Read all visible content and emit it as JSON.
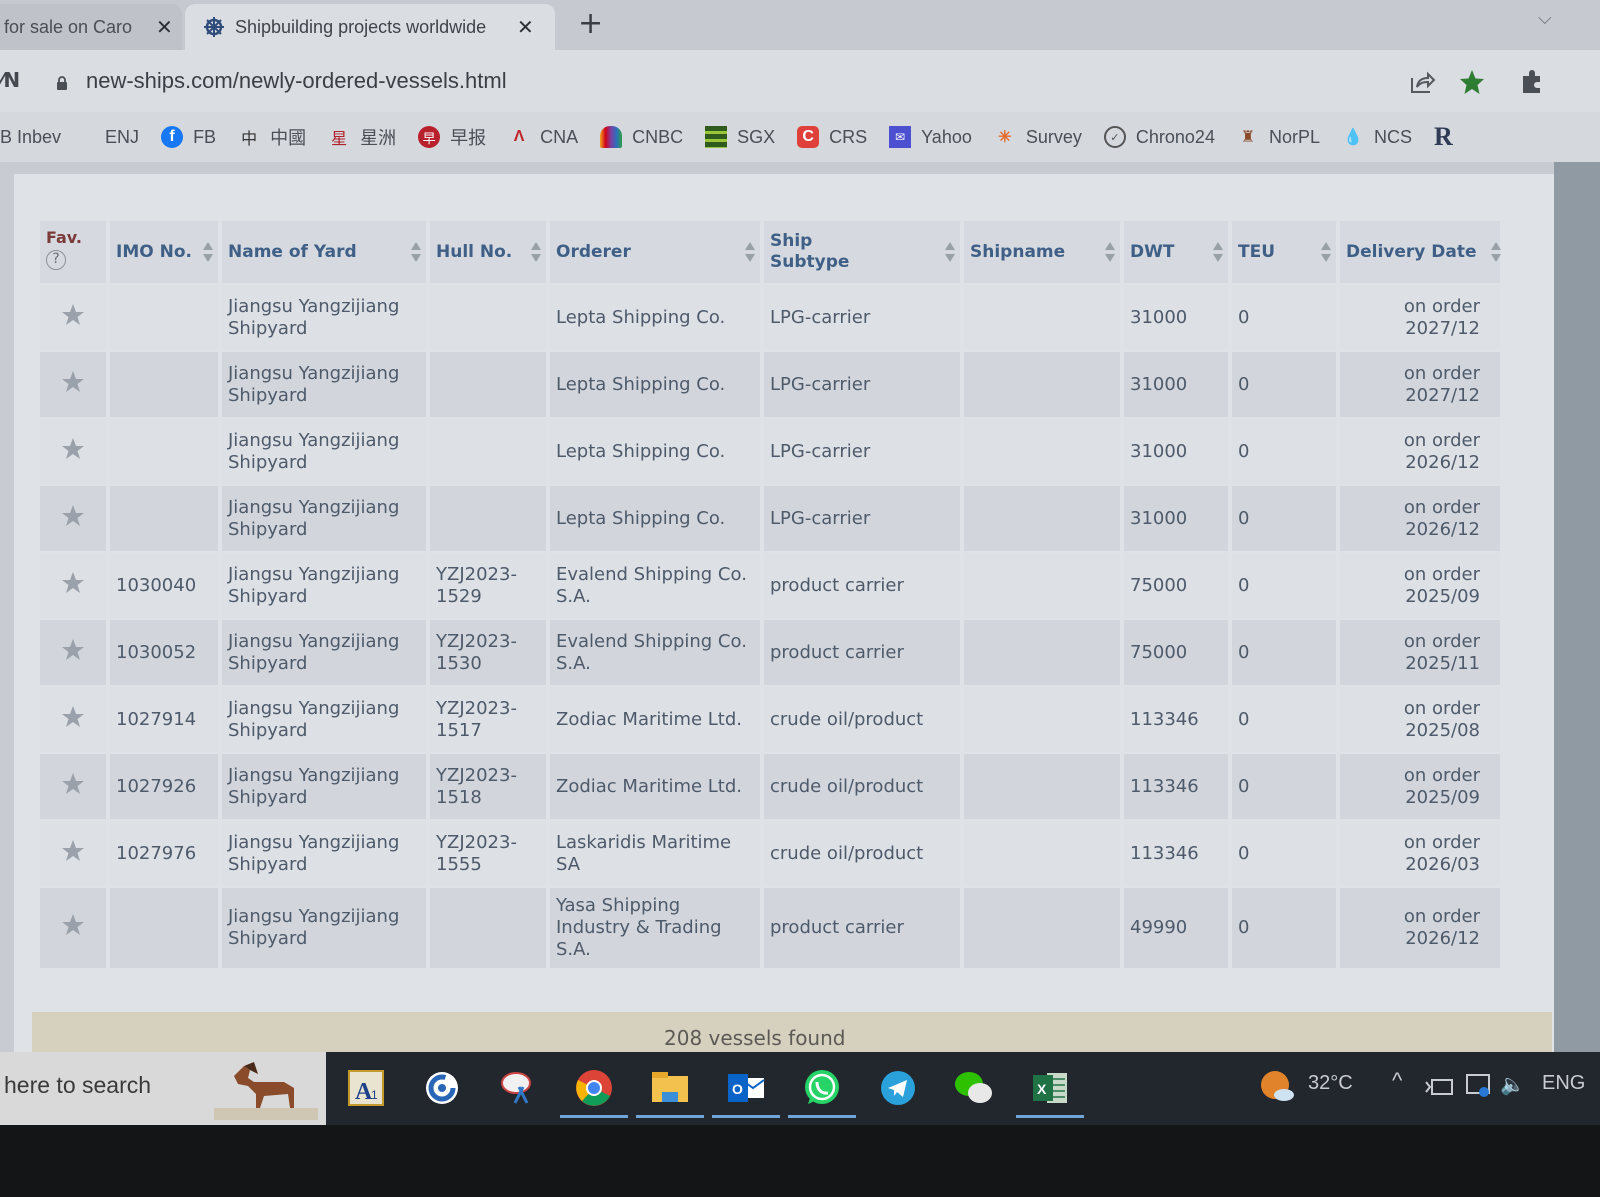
{
  "browser": {
    "tabs": [
      {
        "title": "for sale on Caro",
        "active": false
      },
      {
        "title": "Shipbuilding projects worldwide",
        "active": true
      }
    ],
    "new_tab": "+",
    "url": "new-ships.com/newly-ordered-vessels.html",
    "bookmarks": [
      {
        "label": "B Inbev",
        "icon": "none"
      },
      {
        "label": "ENJ",
        "icon": "none"
      },
      {
        "label": "FB",
        "icon": "facebook-icon"
      },
      {
        "label": "中國",
        "icon": "zhong-icon"
      },
      {
        "label": "星洲",
        "icon": "xingzhou-icon"
      },
      {
        "label": "早报",
        "icon": "zaobao-icon"
      },
      {
        "label": "CNA",
        "icon": "cna-icon"
      },
      {
        "label": "CNBC",
        "icon": "cnbc-peacock-icon"
      },
      {
        "label": "SGX",
        "icon": "sgx-icon"
      },
      {
        "label": "CRS",
        "icon": "crs-icon"
      },
      {
        "label": "Yahoo",
        "icon": "mail-icon"
      },
      {
        "label": "Survey",
        "icon": "survey-icon"
      },
      {
        "label": "Chrono24",
        "icon": "chrono24-icon"
      },
      {
        "label": "NorPL",
        "icon": "norpl-icon"
      },
      {
        "label": "NCS",
        "icon": "drop-icon"
      },
      {
        "label": "R",
        "icon": "none"
      }
    ]
  },
  "table": {
    "headers": {
      "fav": "Fav.",
      "fav_help": "?",
      "imo": "IMO No.",
      "yard": "Name of Yard",
      "hull": "Hull No.",
      "orderer": "Orderer",
      "subtype_line1": "Ship",
      "subtype_line2": "Subtype",
      "shipname": "Shipname",
      "dwt": "DWT",
      "teu": "TEU",
      "delivery": "Delivery Date"
    },
    "rows": [
      {
        "imo": "",
        "yard": "Jiangsu Yangzijiang Shipyard",
        "hull": "",
        "orderer": "Lepta Shipping Co.",
        "subtype": "LPG-carrier",
        "shipname": "",
        "dwt": "31000",
        "teu": "0",
        "status": "on order",
        "date": "2027/12"
      },
      {
        "imo": "",
        "yard": "Jiangsu Yangzijiang Shipyard",
        "hull": "",
        "orderer": "Lepta Shipping Co.",
        "subtype": "LPG-carrier",
        "shipname": "",
        "dwt": "31000",
        "teu": "0",
        "status": "on order",
        "date": "2027/12"
      },
      {
        "imo": "",
        "yard": "Jiangsu Yangzijiang Shipyard",
        "hull": "",
        "orderer": "Lepta Shipping Co.",
        "subtype": "LPG-carrier",
        "shipname": "",
        "dwt": "31000",
        "teu": "0",
        "status": "on order",
        "date": "2026/12"
      },
      {
        "imo": "",
        "yard": "Jiangsu Yangzijiang Shipyard",
        "hull": "",
        "orderer": "Lepta Shipping Co.",
        "subtype": "LPG-carrier",
        "shipname": "",
        "dwt": "31000",
        "teu": "0",
        "status": "on order",
        "date": "2026/12"
      },
      {
        "imo": "1030040",
        "yard": "Jiangsu Yangzijiang Shipyard",
        "hull": "YZJ2023-1529",
        "orderer": "Evalend Shipping Co. S.A.",
        "subtype": "product carrier",
        "shipname": "",
        "dwt": "75000",
        "teu": "0",
        "status": "on order",
        "date": "2025/09"
      },
      {
        "imo": "1030052",
        "yard": "Jiangsu Yangzijiang Shipyard",
        "hull": "YZJ2023-1530",
        "orderer": "Evalend Shipping Co. S.A.",
        "subtype": "product carrier",
        "shipname": "",
        "dwt": "75000",
        "teu": "0",
        "status": "on order",
        "date": "2025/11"
      },
      {
        "imo": "1027914",
        "yard": "Jiangsu Yangzijiang Shipyard",
        "hull": "YZJ2023-1517",
        "orderer": "Zodiac Maritime Ltd.",
        "subtype": "crude oil/product",
        "shipname": "",
        "dwt": "113346",
        "teu": "0",
        "status": "on order",
        "date": "2025/08"
      },
      {
        "imo": "1027926",
        "yard": "Jiangsu Yangzijiang Shipyard",
        "hull": "YZJ2023-1518",
        "orderer": "Zodiac Maritime Ltd.",
        "subtype": "crude oil/product",
        "shipname": "",
        "dwt": "113346",
        "teu": "0",
        "status": "on order",
        "date": "2025/09"
      },
      {
        "imo": "1027976",
        "yard": "Jiangsu Yangzijiang Shipyard",
        "hull": "YZJ2023-1555",
        "orderer": "Laskaridis Maritime SA",
        "subtype": "crude oil/product",
        "shipname": "",
        "dwt": "113346",
        "teu": "0",
        "status": "on order",
        "date": "2026/03"
      },
      {
        "imo": "",
        "yard": "Jiangsu Yangzijiang Shipyard",
        "hull": "",
        "orderer": "Yasa Shipping Industry & Trading S.A.",
        "subtype": "product carrier",
        "shipname": "",
        "dwt": "49990",
        "teu": "0",
        "status": "on order",
        "date": "2026/12"
      }
    ],
    "footer": "208 vessels found"
  },
  "taskbar": {
    "search_placeholder": "here to search",
    "apps": [
      "a1-dictionary-icon",
      "ccleaner-icon",
      "snipping-tool-icon",
      "chrome-icon",
      "file-explorer-icon",
      "outlook-icon",
      "whatsapp-icon",
      "telegram-icon",
      "wechat-icon",
      "excel-icon"
    ],
    "temperature": "32°C",
    "language": "ENG"
  },
  "colors": {
    "header_text": "#3f5f86",
    "fav_header": "#7a3a3a",
    "bookmark_star": "#2e7d32"
  }
}
